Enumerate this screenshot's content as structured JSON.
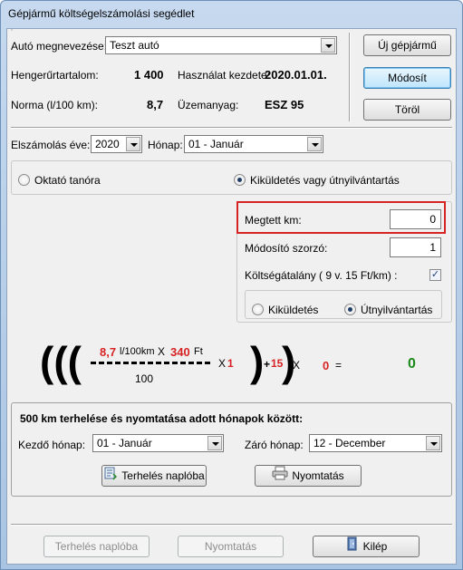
{
  "window": {
    "title": "Gépjármű költségelszámolási segédlet"
  },
  "car": {
    "name_label": "Autó megnevezése:",
    "name_value": "Teszt autó",
    "cylinder_label": "Hengerűrtartalom:",
    "cylinder_value": "1 400",
    "start_label": "Használat kezdete:",
    "start_value": "2020.01.01.",
    "norm_label": "Norma (l/100 km):",
    "norm_value": "8,7",
    "fuel_label": "Üzemanyag:",
    "fuel_value": "ESZ 95"
  },
  "side_buttons": {
    "new": "Új gépjármű",
    "modify": "Módosít",
    "delete": "Töröl"
  },
  "period": {
    "year_label": "Elszámolás éve:",
    "year_value": "2020",
    "month_label": "Hónap:",
    "month_value": "01 - Január"
  },
  "mode": {
    "option_a": "Oktató tanóra",
    "option_b": "Kiküldetés vagy útnyilvántartás",
    "selected": "option_b"
  },
  "travel": {
    "km_label": "Megtett km:",
    "km_value": "0",
    "multiplier_label": "Módosító szorzó:",
    "multiplier_value": "1",
    "allowance_label": "Költségátalány ( 9 v. 15 Ft/km) :",
    "allowance_checked": "✓",
    "sub_a": "Kiküldetés",
    "sub_b": "Útnyilvántartás",
    "sub_selected": "sub_b"
  },
  "formula": {
    "norm": "8,7",
    "unit": "l/100km",
    "times": "X",
    "price": "340",
    "currency": "Ft",
    "divisor": "100",
    "mult_x": "X",
    "mult": "1",
    "plus": "+",
    "allowance": "15",
    "km_x": "X",
    "km": "0",
    "equals": "=",
    "result": "0"
  },
  "batch": {
    "title": "500 km terhelése és nyomtatása adott hónapok között:",
    "start_label": "Kezdő hónap:",
    "start_value": "01 - Január",
    "end_label": "Záró hónap:",
    "end_value": "12 - December",
    "log_button": "Terhelés naplóba",
    "print_button": "Nyomtatás"
  },
  "footer": {
    "log_button": "Terhelés naplóba",
    "print_button": "Nyomtatás",
    "exit_button": "Kilép"
  }
}
